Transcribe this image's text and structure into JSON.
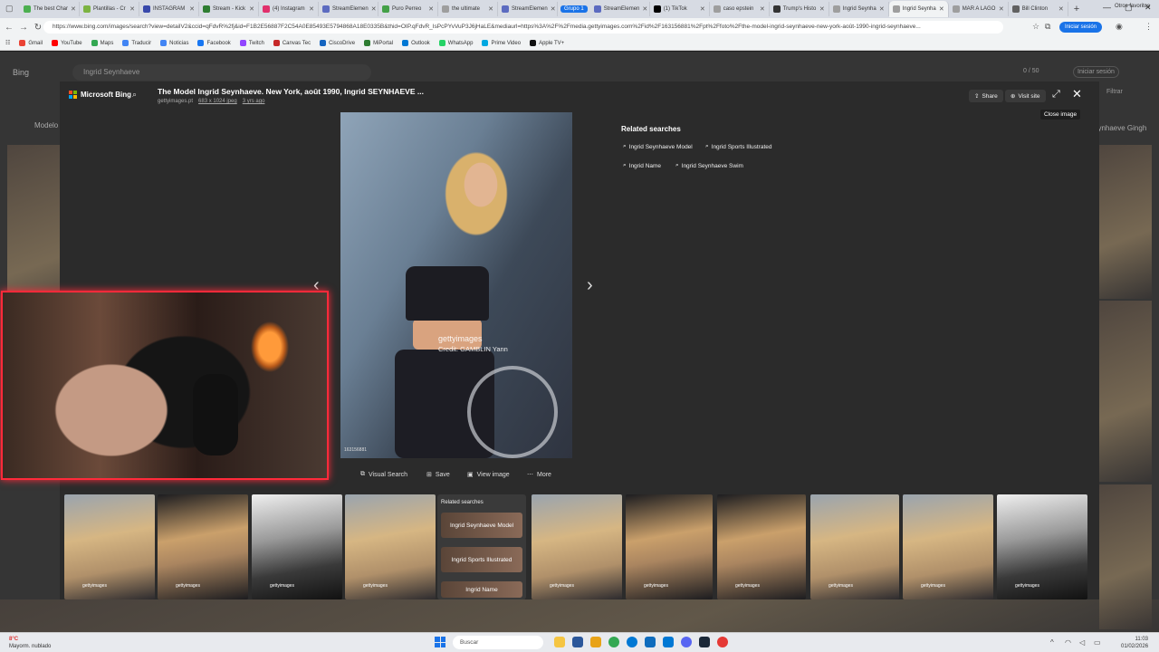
{
  "browser": {
    "tabs": [
      {
        "label": "The best Char",
        "color": "#4caf50"
      },
      {
        "label": "Plantillas - Cr",
        "color": "#7cb342"
      },
      {
        "label": "INSTAGRAM",
        "color": "#3949ab"
      },
      {
        "label": "Stream - Kick",
        "color": "#2e7d32"
      },
      {
        "label": "(4) Instagram",
        "color": "#e1306c"
      },
      {
        "label": "StreamElemen",
        "color": "#5c6bc0"
      },
      {
        "label": "Puro Perreo",
        "color": "#43a047"
      },
      {
        "label": "the ultimate",
        "color": "#9e9e9e"
      },
      {
        "label": "StreamElemen",
        "color": "#5c6bc0"
      },
      {
        "label": "StreamElemen",
        "color": "#5c6bc0"
      },
      {
        "label": "(1) TikTok",
        "color": "#000000"
      },
      {
        "label": "caso epstein",
        "color": "#9e9e9e"
      },
      {
        "label": "Trump's Histo",
        "color": "#333333"
      },
      {
        "label": "Ingrid Seynha",
        "color": "#9e9e9e"
      },
      {
        "label": "Ingrid Seynha",
        "color": "#9e9e9e"
      },
      {
        "label": "MAR A LAGO",
        "color": "#9e9e9e"
      },
      {
        "label": "Bill Clinton",
        "color": "#616161"
      }
    ],
    "tab_group_label": "Grupo 1",
    "url": "https://www.bing.com/images/search?view=detailV2&ccid=qFdvR%2fj&id=F1B2E56887F2C54A0E85493E5794868A18E0335B&thid=OIP.qFdvR_IsPcPYvVuP3J6jHaLE&mediaurl=https%3A%2F%2Fmedia.gettyimages.com%2Fid%2F163156881%2Fpt%2Ffoto%2Fthe-model-ingrid-seynhaeve-new-york-août-1990-ingrid-seynhaeve...",
    "sign_in_label": "Iniciar sesión",
    "bookmarks": [
      {
        "label": "Gmail",
        "color": "#ea4335"
      },
      {
        "label": "YouTube",
        "color": "#ff0000"
      },
      {
        "label": "Maps",
        "color": "#34a853"
      },
      {
        "label": "Traducir",
        "color": "#4285f4"
      },
      {
        "label": "Noticias",
        "color": "#4285f4"
      },
      {
        "label": "Facebook",
        "color": "#1877f2"
      },
      {
        "label": "Twitch",
        "color": "#9146ff"
      },
      {
        "label": "Canvas Tec",
        "color": "#c62828"
      },
      {
        "label": "CiscoDrive",
        "color": "#1565c0"
      },
      {
        "label": "MiPortal",
        "color": "#2e7d32"
      },
      {
        "label": "Outlook",
        "color": "#0078d4"
      },
      {
        "label": "WhatsApp",
        "color": "#25d366"
      },
      {
        "label": "Prime Video",
        "color": "#00a8e1"
      },
      {
        "label": "Apple TV+",
        "color": "#111111"
      }
    ],
    "other_bookmarks_label": "Otros favoritos"
  },
  "bing_page": {
    "logo": "Bing",
    "search_value": "Ingrid Seynhaeve",
    "count": "0 / 50",
    "login_label": "Iniciar sesión",
    "filter_label": "Filtrar",
    "left_label": "Modelo",
    "right_label": "eynhaeve Gingh"
  },
  "modal": {
    "brand": "Microsoft Bing",
    "title": "The Model Ingrid Seynhaeve. New York, août 1990, Ingrid SEYNHAEVE ...",
    "source": "gettyimages.pt",
    "dimensions": "683 x 1024 jpeg",
    "age": "3 yrs ago",
    "share_label": "Share",
    "visit_site_label": "Visit site",
    "close_tooltip": "Close image",
    "watermark": "gettyimages",
    "credit": "Credit: GAMBLIN Yann",
    "image_id": "163156881",
    "related_title": "Related searches",
    "related": [
      "Ingrid Seynhaeve Model",
      "Ingrid Sports Illustrated",
      "Ingrid Name",
      "Ingrid Seynhaeve Swim"
    ],
    "actions": {
      "visual_search": "Visual Search",
      "save": "Save",
      "view_image": "View image",
      "more": "More"
    },
    "related_card": {
      "title": "Related searches",
      "items": [
        "Ingrid Seynhaeve Model",
        "Ingrid Sports Illustrated",
        "Ingrid Name"
      ]
    },
    "thumb_caption": "gettyimages"
  },
  "taskbar": {
    "weather_temp": "8°C",
    "weather_desc": "Mayorm. nublado",
    "search_placeholder": "Buscar",
    "time": "11:03",
    "date": "01/02/2026"
  }
}
